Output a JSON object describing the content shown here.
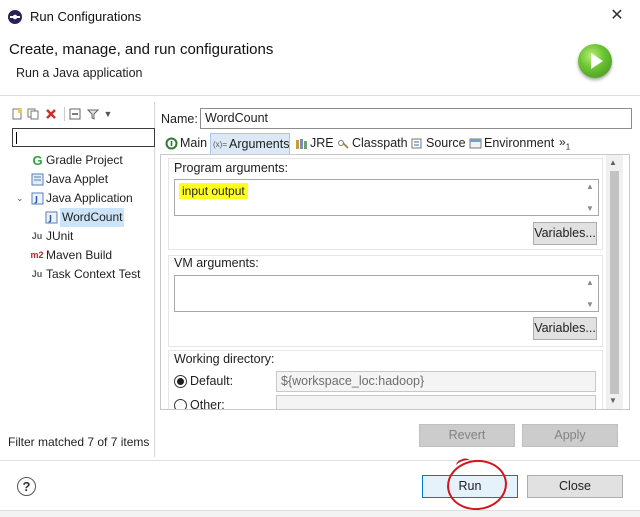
{
  "window": {
    "title": "Run Configurations",
    "close_label": "✕"
  },
  "header": {
    "title": "Create, manage, and run configurations",
    "subtitle": "Run a Java application"
  },
  "sidebar": {
    "toolbar": [
      "new-config-icon",
      "duplicate-icon",
      "delete-icon",
      "collapse-all-icon",
      "filter-icon"
    ],
    "filter_value": "",
    "items": [
      {
        "label": "Gradle Project",
        "icon": "G"
      },
      {
        "label": "Java Applet",
        "icon": "applet"
      },
      {
        "label": "Java Application",
        "icon": "J"
      },
      {
        "label": "WordCount",
        "icon": "J"
      },
      {
        "label": "JUnit",
        "icon": "Ju"
      },
      {
        "label": "Maven Build",
        "icon": "m2"
      },
      {
        "label": "Task Context Test",
        "icon": "Ju"
      }
    ],
    "status": "Filter matched 7 of 7 items"
  },
  "config": {
    "name_label": "Name:",
    "name_value": "WordCount",
    "tabs": [
      {
        "label": "Main"
      },
      {
        "label": "Arguments"
      },
      {
        "label": "JRE"
      },
      {
        "label": "Classpath"
      },
      {
        "label": "Source"
      },
      {
        "label": "Environment"
      }
    ],
    "tab_overflow": "»",
    "tab_overflow_count": "1",
    "program_args_label": "Program arguments:",
    "program_args_value": "input output",
    "variables_label": "Variables...",
    "vm_args_label": "VM arguments:",
    "vm_args_value": "",
    "working_dir_label": "Working directory:",
    "default_label": "Default:",
    "default_value": "${workspace_loc:hadoop}",
    "other_label": "Other:"
  },
  "actions": {
    "revert": "Revert",
    "apply": "Apply",
    "run": "Run",
    "close": "Close",
    "help": "?"
  },
  "colors": {
    "highlight": "#ffff1e",
    "run_icon_green": "#4fa82a",
    "annotation_red": "#d0161c",
    "selected_row": "#cce4f7"
  }
}
